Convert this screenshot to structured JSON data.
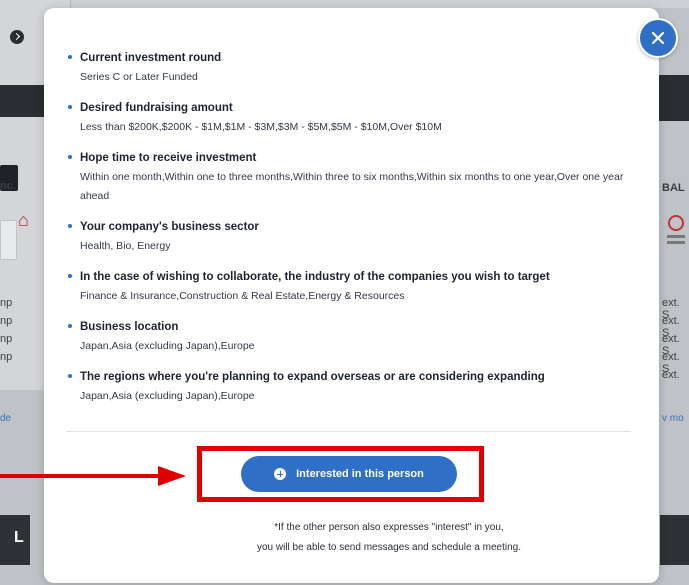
{
  "background": {
    "left_snippets": [
      "nc.",
      "np",
      "np",
      "np",
      "np",
      "de",
      "L"
    ],
    "right_snippets": [
      "BAL",
      "ext. S",
      "ext. S",
      "ext. S",
      "ext. S",
      "ext.",
      "v mo"
    ]
  },
  "modal": {
    "items": [
      {
        "label": "Current investment round",
        "value": "Series C or Later Funded"
      },
      {
        "label": "Desired fundraising amount",
        "value": "Less than $200K,$200K - $1M,$1M - $3M,$3M - $5M,$5M - $10M,Over $10M"
      },
      {
        "label": "Hope time to receive investment",
        "value": "Within one month,Within one to three months,Within three to six months,Within six months to one year,Over one year ahead"
      },
      {
        "label": "Your company's business sector",
        "value": "Health, Bio, Energy"
      },
      {
        "label": "In the case of wishing to collaborate, the industry of the companies you wish to target",
        "value": "Finance & Insurance,Construction & Real Estate,Energy & Resources"
      },
      {
        "label": "Business location",
        "value": "Japan,Asia (excluding Japan),Europe"
      },
      {
        "label": "The regions where you're planning to expand overseas or are considering expanding",
        "value": "Japan,Asia (excluding Japan),Europe"
      }
    ],
    "cta_label": "Interested in this person",
    "note_line1": "*If the other person also expresses \"interest\" in you,",
    "note_line2": "you will be able to send messages and schedule a meeting."
  },
  "colors": {
    "accent": "#2f6fc6",
    "highlight": "#e00000"
  },
  "icons": {
    "close": "close-icon",
    "cta": "plus-circle-icon"
  }
}
